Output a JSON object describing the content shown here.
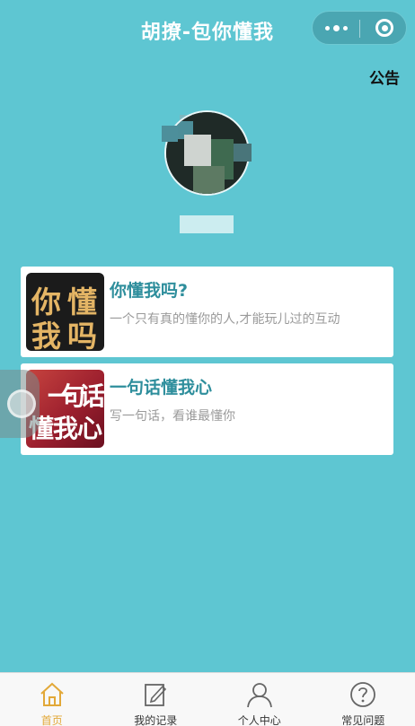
{
  "header": {
    "title": "胡撩-包你懂我"
  },
  "notice_label": "公告",
  "cards": [
    {
      "title": "你懂我吗?",
      "desc": "一个只有真的懂你的人,才能玩儿过的互动",
      "thumb_chars": [
        "你",
        "懂",
        "我",
        "吗"
      ]
    },
    {
      "title": "一句话懂我心",
      "desc": "写一句话，看谁最懂你",
      "thumb_chars": [
        "一",
        "句",
        "话",
        "懂",
        "我",
        "心"
      ]
    }
  ],
  "tabs": [
    {
      "label": "首页",
      "icon": "home-icon",
      "active": true
    },
    {
      "label": "我的记录",
      "icon": "edit-record-icon",
      "active": false
    },
    {
      "label": "个人中心",
      "icon": "user-icon",
      "active": false
    },
    {
      "label": "常见问题",
      "icon": "question-icon",
      "active": false
    }
  ],
  "colors": {
    "background": "#5ec6d2",
    "accent_title": "#2e8e9c",
    "tab_active": "#e2a838"
  }
}
